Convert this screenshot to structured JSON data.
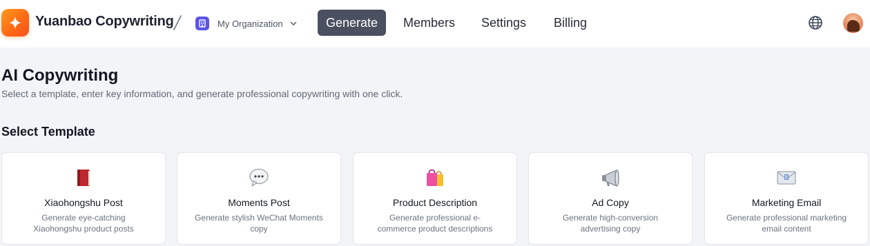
{
  "app": {
    "title": "Yuanbao Copywriting"
  },
  "org": {
    "name": "My Organization"
  },
  "nav": {
    "items": [
      {
        "label": "Generate",
        "active": true
      },
      {
        "label": "Members",
        "active": false
      },
      {
        "label": "Settings",
        "active": false
      },
      {
        "label": "Billing",
        "active": false
      }
    ]
  },
  "page": {
    "title": "AI Copywriting",
    "subtitle": "Select a template, enter key information, and generate professional copywriting with one click.",
    "section_title": "Select Template"
  },
  "templates": [
    {
      "icon": "red-book-icon",
      "title": "Xiaohongshu Post",
      "description": "Generate eye-catching Xiaohongshu product posts"
    },
    {
      "icon": "speech-bubble-icon",
      "title": "Moments Post",
      "description": "Generate stylish WeChat Moments copy"
    },
    {
      "icon": "shopping-bags-icon",
      "title": "Product Description",
      "description": "Generate professional e-commerce product descriptions"
    },
    {
      "icon": "megaphone-icon",
      "title": "Ad Copy",
      "description": "Generate high-conversion advertising copy"
    },
    {
      "icon": "envelope-icon",
      "title": "Marketing Email",
      "description": "Generate professional marketing email content"
    }
  ],
  "colors": {
    "accent_orange": "#ff7a18",
    "nav_active_bg": "#4b5060",
    "org_badge": "#5b54e8",
    "page_bg": "#f3f4f8"
  }
}
